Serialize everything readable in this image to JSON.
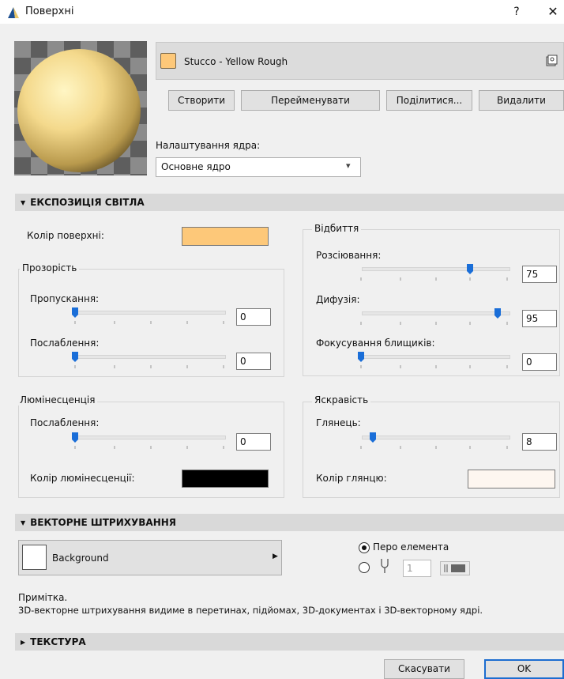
{
  "window": {
    "title": "Поверхні",
    "help": "?",
    "close": "✕"
  },
  "material": {
    "name": "Stucco - Yellow Rough",
    "swatch_color": "#fdc879"
  },
  "buttons": {
    "create": "Створити",
    "rename": "Перейменувати",
    "share": "Поділитися...",
    "delete": "Видалити"
  },
  "core": {
    "label": "Налаштування ядра:",
    "value": "Основне ядро"
  },
  "exposure": {
    "header": "ЕКСПОЗИЦІЯ СВІТЛА",
    "surface_color_label": "Колір поверхні:",
    "surface_color": "#fdc879",
    "transparency": {
      "title": "Прозорість",
      "transmission_label": "Пропускання:",
      "transmission_value": "0",
      "attenuation_label": "Послаблення:",
      "attenuation_value": "0"
    },
    "reflection": {
      "title": "Відбиття",
      "diffusion_label": "Розсіювання:",
      "diffusion_value": "75",
      "diffuse_label": "Дифузія:",
      "diffuse_value": "95",
      "specular_label": "Фокусування блищиків:",
      "specular_value": "0"
    },
    "luminescence": {
      "title": "Люмінесценція",
      "attenuation_label": "Послаблення:",
      "attenuation_value": "0",
      "color_label": "Колір люмінесценції:",
      "color": "#000000"
    },
    "brightness": {
      "title": "Яскравість",
      "gloss_label": "Глянець:",
      "gloss_value": "8",
      "gloss_color_label": "Колір глянцю:",
      "gloss_color": "#fdf6f0"
    }
  },
  "vector_hatch": {
    "header": "ВЕКТОРНЕ ШТРИХУВАННЯ",
    "background_label": "Background",
    "pen_element_label": "Перо елемента",
    "pen_number": "1",
    "note_title": "Примітка.",
    "note_text": "3D-векторне штрихування видиме в перетинах, підйомах, 3D-документах і 3D-векторному ядрі."
  },
  "texture": {
    "header": "ТЕКСТУРА"
  },
  "footer": {
    "cancel": "Скасувати",
    "ok": "OK"
  },
  "colors": {
    "accent": "#1c6dd0",
    "slider_thumb": "#1a6ed8"
  }
}
